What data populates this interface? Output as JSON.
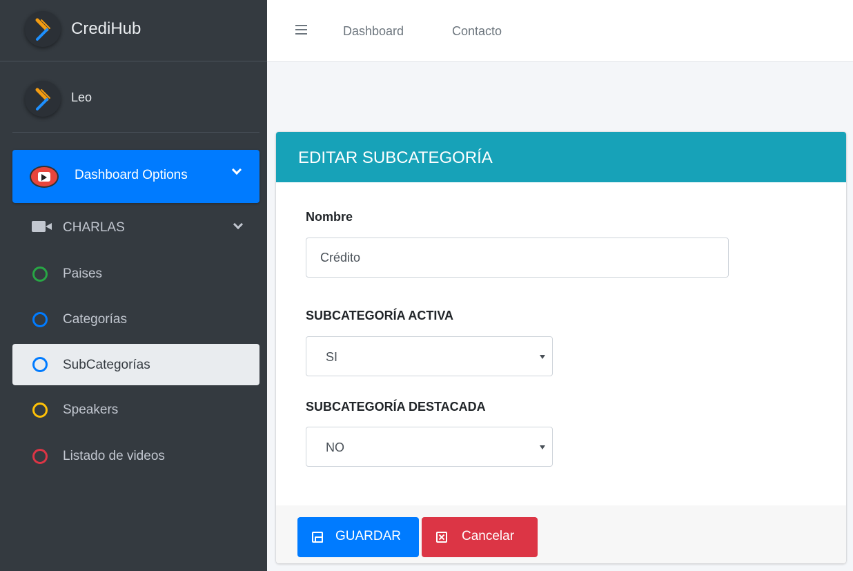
{
  "brand": {
    "name": "CrediHub"
  },
  "user": {
    "name": "Leo"
  },
  "sidebar": {
    "active_item": {
      "label": "Dashboard Options",
      "icon": "youtube-icon"
    },
    "group": {
      "label": "CHARLAS",
      "icon": "video-camera-icon"
    },
    "items": [
      {
        "label": "Paises",
        "color": "#28a745"
      },
      {
        "label": "Categorías",
        "color": "#007bff"
      },
      {
        "label": "SubCategorías",
        "color": "#007bff",
        "selected": true
      },
      {
        "label": "Speakers",
        "color": "#ffc107"
      },
      {
        "label": "Listado de videos",
        "color": "#dc3545"
      }
    ]
  },
  "topbar": {
    "links": [
      "Dashboard",
      "Contacto"
    ]
  },
  "card": {
    "title": "EDITAR SUBCATEGORÍA",
    "header_color": "#17a2b8",
    "nombre_label": "Nombre",
    "nombre_value": "Crédito",
    "activa_label": "SUBCATEGORÍA ACTIVA",
    "activa_value": "SI",
    "destacada_label": "SUBCATEGORÍA DESTACADA",
    "destacada_value": "NO"
  },
  "buttons": {
    "save": "GUARDAR",
    "cancel": "Cancelar"
  }
}
